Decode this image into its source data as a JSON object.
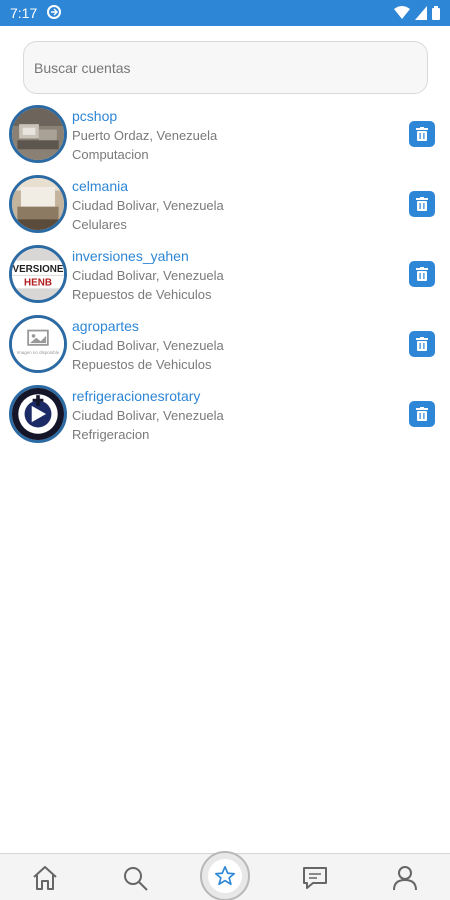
{
  "status_bar": {
    "time": "7:17"
  },
  "search": {
    "placeholder": "Buscar cuentas"
  },
  "accounts": [
    {
      "name": "pcshop",
      "location": "Puerto Ordaz, Venezuela",
      "category": "Computacion"
    },
    {
      "name": "celmania",
      "location": "Ciudad Bolivar, Venezuela",
      "category": "Celulares"
    },
    {
      "name": "inversiones_yahen",
      "location": "Ciudad Bolivar, Venezuela",
      "category": "Repuestos de Vehiculos"
    },
    {
      "name": "agropartes",
      "location": "Ciudad Bolivar, Venezuela",
      "category": "Repuestos de Vehiculos"
    },
    {
      "name": "refrigeracionesrotary",
      "location": "Ciudad Bolivar, Venezuela",
      "category": "Refrigeracion"
    }
  ],
  "avatar_texts": {
    "inversiones_yahen": "VERSIONE\nHENB",
    "agropartes": "Imagen no disponible"
  },
  "colors": {
    "accent": "#2e86d6",
    "avatar_border": "#2b6aa3",
    "muted_text": "#7a7a7a"
  },
  "bottom_nav": {
    "items": [
      "home-icon",
      "search-icon",
      "star-icon",
      "chat-icon",
      "user-icon"
    ],
    "active": "star-icon"
  }
}
